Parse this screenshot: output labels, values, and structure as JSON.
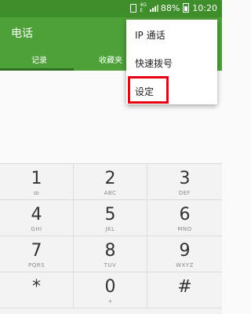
{
  "statusbar": {
    "network": "4G",
    "network_sub": "E",
    "battery": "88%",
    "time": "10:20",
    "icons": [
      "sim-icon",
      "network-4g-icon",
      "signal-icon",
      "battery-icon"
    ]
  },
  "app": {
    "title": "电话"
  },
  "tabs": [
    {
      "label": "记录"
    },
    {
      "label": "收藏夹"
    }
  ],
  "menu": {
    "items": [
      {
        "label": "IP 通话"
      },
      {
        "label": "快速拨号"
      },
      {
        "label": "设定"
      }
    ]
  },
  "keypad": {
    "keys": [
      {
        "num": "1",
        "sub": "ꝏ"
      },
      {
        "num": "2",
        "sub": "ABC"
      },
      {
        "num": "3",
        "sub": "DEF"
      },
      {
        "num": "4",
        "sub": "GHI"
      },
      {
        "num": "5",
        "sub": "JKL"
      },
      {
        "num": "6",
        "sub": "MNO"
      },
      {
        "num": "7",
        "sub": "PQRS"
      },
      {
        "num": "8",
        "sub": "TUV"
      },
      {
        "num": "9",
        "sub": "WXYZ"
      },
      {
        "num": "*",
        "sub": ""
      },
      {
        "num": "0",
        "sub": "+"
      },
      {
        "num": "#",
        "sub": ""
      }
    ]
  },
  "colors": {
    "statusbar": "#3f8e2c",
    "toolbar": "#4ea138",
    "highlight": "#e60012"
  }
}
